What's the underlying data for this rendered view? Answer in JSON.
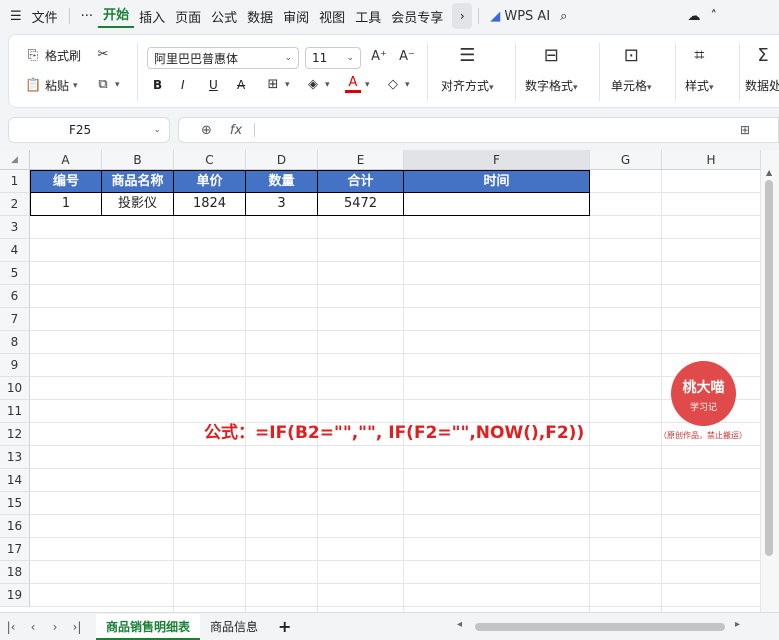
{
  "menubar": {
    "items": [
      "文件",
      "开始",
      "插入",
      "页面",
      "公式",
      "数据",
      "审阅",
      "视图",
      "工具",
      "会员专享"
    ],
    "active": "开始",
    "wps_ai": "WPS AI"
  },
  "ribbon": {
    "format_painter": "格式刷",
    "paste": "粘贴",
    "font_name": "阿里巴巴普惠体",
    "font_size": "11",
    "bold": "B",
    "italic": "I",
    "underline": "U",
    "strike": "A",
    "align": "对齐方式",
    "number_format": "数字格式",
    "cell": "单元格",
    "style": "样式",
    "data_proc": "数据处"
  },
  "formula_bar": {
    "cell_ref": "F25",
    "fx": "fx",
    "content": ""
  },
  "columns": [
    "A",
    "B",
    "C",
    "D",
    "E",
    "F",
    "G",
    "H"
  ],
  "selected_column": "F",
  "rows": [
    "1",
    "2",
    "3",
    "4",
    "5",
    "6",
    "7",
    "8",
    "9",
    "10",
    "11",
    "12",
    "13",
    "14",
    "15",
    "16",
    "17",
    "18",
    "19"
  ],
  "table": {
    "headers": [
      "编号",
      "商品名称",
      "单价",
      "数量",
      "合计",
      "时间"
    ],
    "row": [
      "1",
      "投影仪",
      "1824",
      "3",
      "5472",
      ""
    ]
  },
  "annotation": "公式：=IF(B2=\"\",\"\", IF(F2=\"\",NOW(),F2))",
  "badge": {
    "line1": "桃大喵",
    "line2": "学习记",
    "sub": "（原创作品，禁止搬运）"
  },
  "sheets": [
    "商品销售明细表",
    "商品信息"
  ],
  "active_sheet": "商品销售明细表",
  "colors": {
    "header_fill": "#4472c4",
    "accent": "#1a7f37",
    "annotation": "#e02020"
  }
}
